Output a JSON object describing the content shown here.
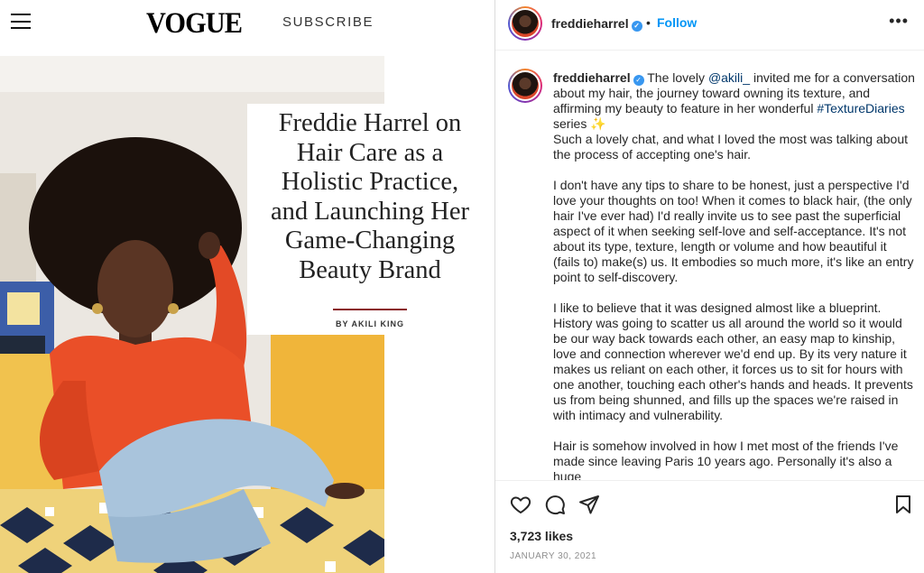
{
  "vogue": {
    "logo": "VOGUE",
    "subscribe": "SUBSCRIBE",
    "headline_lines": [
      "Freddie Harrel on",
      "Hair Care as a",
      "Holistic Practice,",
      "and Launching Her",
      "Game-Changing",
      "Beauty Brand"
    ],
    "byline": "BY AKILI KING"
  },
  "post": {
    "username": "freddieharrel",
    "follow": "Follow",
    "more": "•••",
    "caption": {
      "p1_a": " The lovely ",
      "mention": "@akili_",
      "p1_b": " invited me for a conversation about my hair, the journey toward owning its texture, and affirming my beauty to feature in her wonderful ",
      "hashtag": "#TextureDiaries",
      "p1_c": " series ✨",
      "p1_d": "Such a lovely chat, and what I loved the most was talking about the process of accepting one's hair.",
      "p2": "I don't have any tips to share to be honest, just a perspective I'd love your thoughts on too! When it comes to black hair, (the only hair I've ever had) I'd really invite us to see past the superficial aspect of it when seeking self-love and self-acceptance. It's not about its type, texture, length or volume and how beautiful it (fails to) make(s) us. It embodies so much more, it's like an entry point to self-discovery.",
      "p3": "I like to believe that it was designed almost like a blueprint. History was going to scatter us all around the world so it would be our way back towards each other, an easy map to kinship, love and connection wherever we'd end up. By its very nature it makes us reliant on each other, it forces us to sit for hours with one another, touching each other's hands and heads. It prevents us from being shunned, and fills up the spaces we're raised in with intimacy and vulnerability.",
      "p4": "Hair is somehow involved in how I met most of the friends I've made since leaving Paris 10 years ago. Personally it's also a huge"
    },
    "likes": "3,723 likes",
    "date": "JANUARY 30, 2021"
  },
  "icons": [
    "menu-icon",
    "verified-icon",
    "more-icon",
    "heart-icon",
    "comment-icon",
    "share-icon",
    "bookmark-icon"
  ]
}
